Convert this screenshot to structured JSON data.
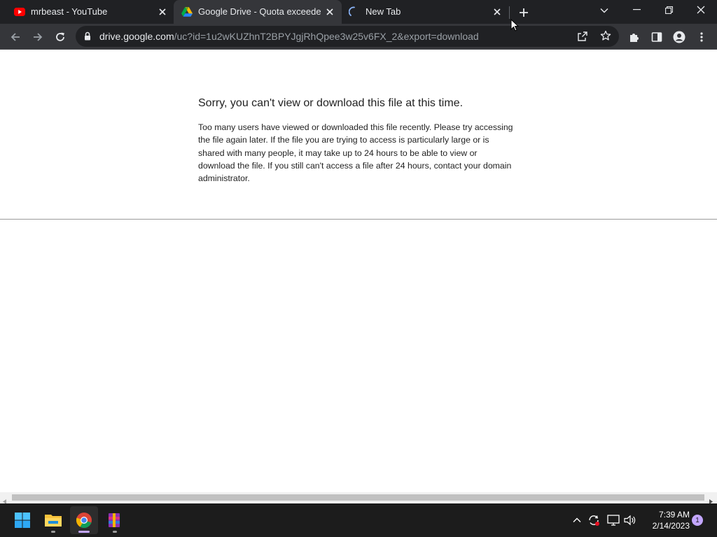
{
  "tabs": [
    {
      "title": "mrbeast - YouTube",
      "icon": "youtube-icon",
      "active": false
    },
    {
      "title": "Google Drive - Quota exceeded",
      "icon": "google-drive-icon",
      "active": true
    },
    {
      "title": "New Tab",
      "icon": "loading-spinner-icon",
      "active": false
    }
  ],
  "omnibox": {
    "host": "drive.google.com",
    "path": "/uc?id=1u2wKUZhnT2BPYJgjRhQpee3w25v6FX_2&export=download"
  },
  "page": {
    "title": "Sorry, you can't view or download this file at this time.",
    "body": "Too many users have viewed or downloaded this file recently. Please try accessing the file again later. If the file you are trying to access is particularly large or is shared with many people, it may take up to 24 hours to be able to view or download the file. If you still can't access a file after 24 hours, contact your domain administrator."
  },
  "taskbar": {
    "time": "7:39 AM",
    "date": "2/14/2023",
    "notification_count": "1"
  },
  "colors": {
    "titlebar": "#202124",
    "toolbar": "#35363a",
    "taskbar": "#1c1c1c",
    "accent": "#c3a6ff"
  }
}
